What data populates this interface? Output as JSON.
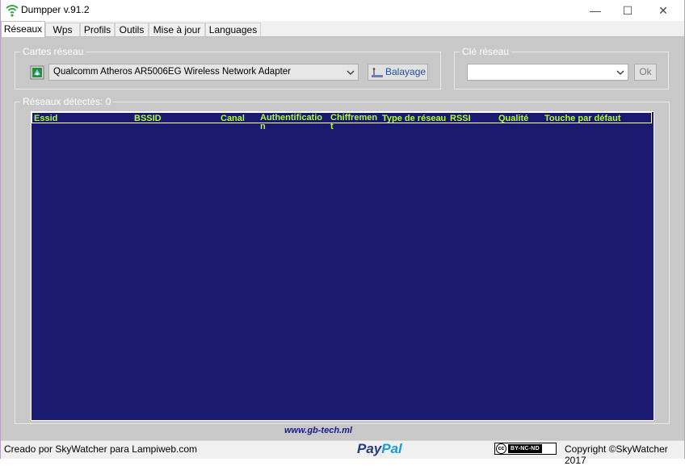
{
  "window": {
    "title": "Dumpper v.91.2",
    "controls": {
      "minimize": "—",
      "maximize": "☐",
      "close": "✕"
    }
  },
  "tabs": [
    {
      "label": "Réseaux",
      "active": true
    },
    {
      "label": "Wps"
    },
    {
      "label": "Profils"
    },
    {
      "label": "Outils"
    },
    {
      "label": "Mise à jour"
    },
    {
      "label": "Languages"
    }
  ],
  "cartes_reseau": {
    "label": "Cartes réseau",
    "adapter": "Qualcomm Atheros AR5006EG Wireless Network Adapter",
    "scan_button": "Balayage"
  },
  "cle_reseau": {
    "label": "Clé réseau",
    "value": "",
    "ok_button": "Ok"
  },
  "networks": {
    "label": "Réseaux détectés:",
    "count": "0",
    "columns": [
      "Essid",
      "BSSID",
      "Canal",
      "Authentificatio\nn",
      "Chiffremen\nt",
      "Type de réseau",
      "RSSI",
      "Qualité",
      "Touche par défaut"
    ],
    "rows": []
  },
  "footer_link": "www.gb-tech.ml",
  "status": {
    "left": "Creado por SkyWatcher para Lampiweb.com",
    "paypal_pay": "Pay",
    "paypal_pal": "Pal",
    "cc_icon": "cc",
    "cc_license": "BY-NC-ND",
    "right": "Copyright ©SkyWatcher 2017"
  },
  "colors": {
    "list_background": "#191970",
    "header_text": "#adff2f",
    "panel_background": "#c8c8c8",
    "paypal_dark": "#253b80",
    "paypal_light": "#179bd7"
  }
}
